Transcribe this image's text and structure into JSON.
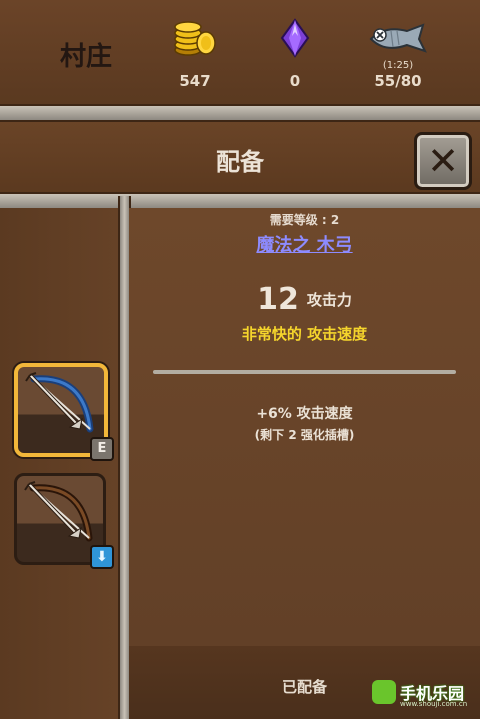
{
  "topbar": {
    "location": "村庄",
    "gold": {
      "icon": "gold-coins-icon",
      "value": "547"
    },
    "gems": {
      "icon": "purple-gem-icon",
      "value": "0"
    },
    "fish": {
      "icon": "fish-icon",
      "timer": "(1:25)",
      "value": "55/80"
    }
  },
  "header": {
    "title": "配备",
    "close_icon": "close-icon"
  },
  "slots": [
    {
      "icon": "bow-icon",
      "selected": true,
      "badge": "E"
    },
    {
      "icon": "bow-icon",
      "selected": false,
      "badge": "down-arrow-icon"
    }
  ],
  "item": {
    "requirement": "需要等级 : 2",
    "name": "魔法之 木弓",
    "attack_value": "12",
    "attack_label": "攻击力",
    "speed": "非常快的 攻击速度",
    "bonus": "+6% 攻击速度",
    "slots_left": "(剩下 2 强化插槽)"
  },
  "footer": {
    "equip_label": "已配备"
  },
  "watermark": {
    "text": "手机乐园",
    "sub": "www.shouji.com.cn"
  },
  "colors": {
    "wood": "#5c3b22",
    "item_name": "#8d8bff",
    "speed_text": "#f5d52c",
    "selected_border": "#f2b73a"
  }
}
